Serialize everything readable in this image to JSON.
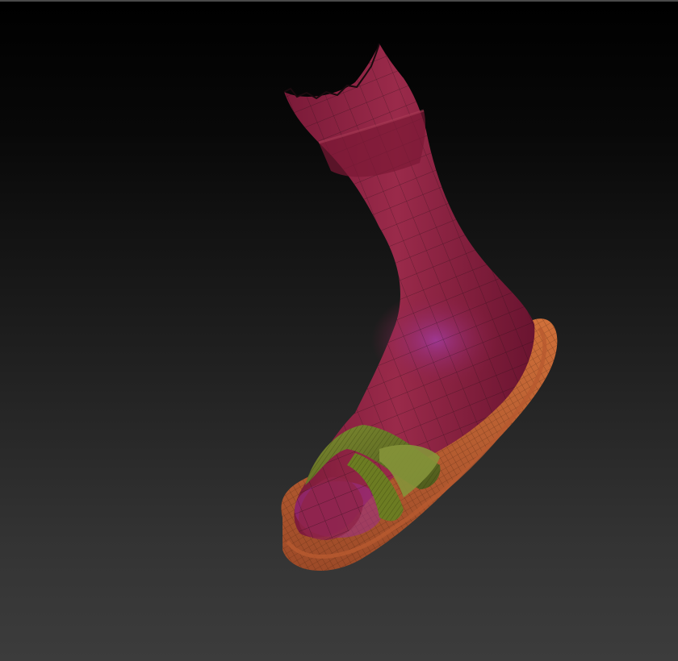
{
  "viewport": {
    "background_top": "#000000",
    "background_bottom": "#3c3c3c"
  },
  "model": {
    "skin_color": "#8c1f3d",
    "skin_highlight": "#a0306a",
    "strap_color": "#6e7a2a",
    "sole_color": "#c8603a",
    "wire_color": "#1a0a10"
  }
}
